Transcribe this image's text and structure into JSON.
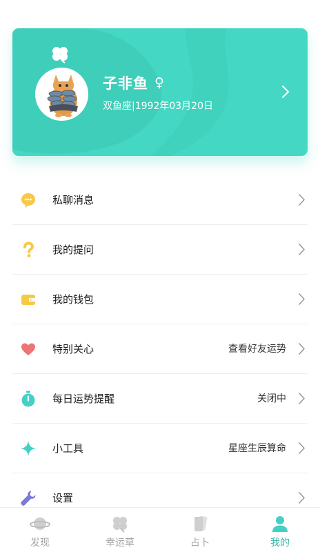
{
  "profile": {
    "name": "子非鱼",
    "gender_symbol": "♀",
    "info": "双鱼座|1992年03月20日",
    "card_color": "#44d7c4"
  },
  "menu": [
    {
      "label": "私聊消息",
      "value": "",
      "icon": "chat-bubble-icon",
      "color": "#f7c948"
    },
    {
      "label": "我的提问",
      "value": "",
      "icon": "question-icon",
      "color": "#f7c948"
    },
    {
      "label": "我的钱包",
      "value": "",
      "icon": "wallet-icon",
      "color": "#f7c948"
    },
    {
      "label": "特别关心",
      "value": "查看好友运势",
      "icon": "heart-icon",
      "color": "#f07474"
    },
    {
      "label": "每日运势提醒",
      "value": "关闭中",
      "icon": "stopwatch-icon",
      "color": "#45d0c6"
    },
    {
      "label": "小工具",
      "value": "星座生辰算命",
      "icon": "sparkle-icon",
      "color": "#45d0c6"
    },
    {
      "label": "设置",
      "value": "",
      "icon": "wrench-icon",
      "color": "#7a7ad8"
    }
  ],
  "tabs": [
    {
      "label": "发现",
      "icon": "planet-icon",
      "active": false
    },
    {
      "label": "幸运草",
      "icon": "clover-icon",
      "active": false
    },
    {
      "label": "占卜",
      "icon": "cards-icon",
      "active": false
    },
    {
      "label": "我的",
      "icon": "person-icon",
      "active": true
    }
  ],
  "colors": {
    "accent": "#44d7c4",
    "tab_active": "#3fb5a8",
    "tab_inactive": "#a5a5a5"
  }
}
